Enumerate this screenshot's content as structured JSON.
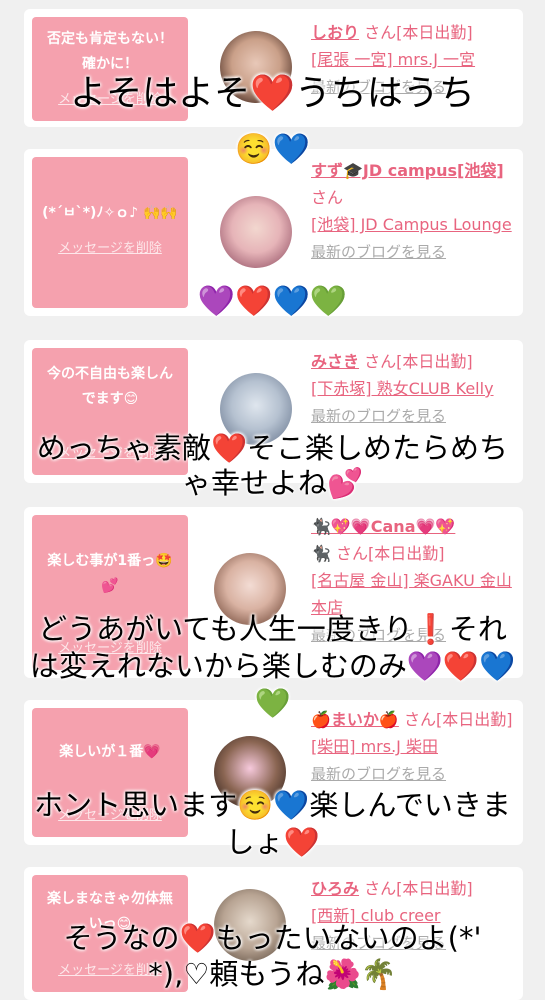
{
  "delete_label": "メッセージを削除",
  "blog_label": "最新のブログを見る",
  "cards": [
    {
      "message": "否定も肯定もない！確かに！",
      "name": "しおり",
      "suffix": "さん[本日出勤]",
      "store": "[尾張 一宮] mrs.J 一宮"
    },
    {
      "message": "(*´ㅂ`*)ﾉ✧ｏ♪ 🙌🙌",
      "name": "すず🎓JD campus[池袋]",
      "suffix": "さん",
      "store": "[池袋] JD Campus Lounge"
    },
    {
      "message": "今の不自由も楽しんでます😊",
      "name": "みさき",
      "suffix": "さん[本日出勤]",
      "store": "[下赤塚] 熟女CLUB Kelly"
    },
    {
      "message": "楽しむ事が1番っ🤩💕",
      "name": "🐈‍⬛💖💗Cana💗💖",
      "suffix": "🐈‍⬛ さん[本日出勤]",
      "store": "[名古屋 金山] 楽GAKU 金山本店"
    },
    {
      "message": "楽しいが１番💗",
      "name": "🍎まいか🍎",
      "suffix": "さん[本日出勤]",
      "store": "[柴田] mrs.J 柴田"
    },
    {
      "message": "楽しまなきゃ勿体無いっ😊",
      "name": "ひろみ",
      "suffix": "さん[本日出勤]",
      "store": "[西新] club creer"
    }
  ],
  "overlay": {
    "line1a": "よそはよそ",
    "line1b": "うちはうち",
    "line2": "☺️💙",
    "line3": "💜❤️💙💚",
    "line4a": "めっちゃ素敵",
    "line4b": "そこ楽しめたらめち",
    "line5": "ゃ幸せよね💕",
    "line6": "どうあがいても人生一度きり❗それ",
    "line7": "は変えれないから楽しむのみ💜❤️💙",
    "line8": "💚",
    "line9": "ホント思います☺️💙楽しんでいきま",
    "line10": "しょ❤️",
    "line11a": "そうなの",
    "line11b": "もったいないのよ(*'",
    "line12": "*),♡頼もうね🌺🌴"
  },
  "colors": {
    "bubble": "#f5a1ae",
    "accent": "#e8647f",
    "heart": "#e01b24"
  }
}
